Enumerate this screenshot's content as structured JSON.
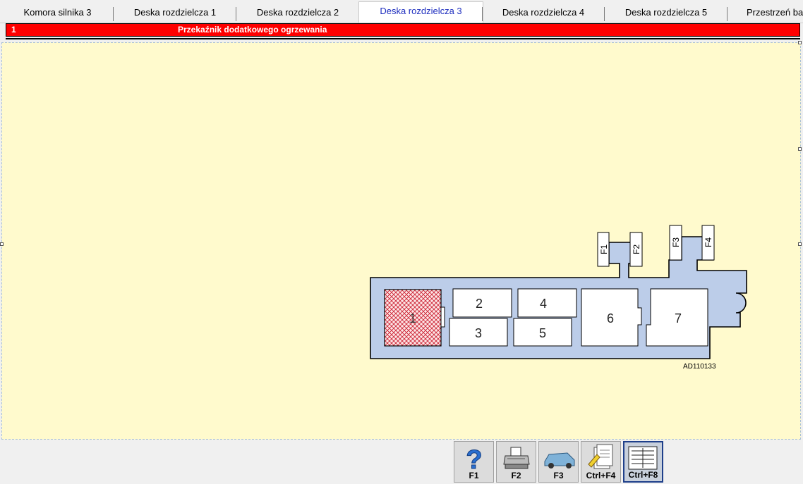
{
  "tabs": [
    {
      "label": "Komora silnika 3",
      "selected": false
    },
    {
      "label": "Deska rozdzielcza 1",
      "selected": false
    },
    {
      "label": "Deska rozdzielcza 2",
      "selected": false
    },
    {
      "label": "Deska rozdzielcza 3",
      "selected": true
    },
    {
      "label": "Deska rozdzielcza 4",
      "selected": false
    },
    {
      "label": "Deska rozdzielcza 5",
      "selected": false
    },
    {
      "label": "Przestrzeń ba",
      "selected": false
    }
  ],
  "header": {
    "number": "1",
    "title": "Przekaźnik dodatkowego ogrzewania",
    "color": "#ff0000"
  },
  "diagram": {
    "fuses": [
      "F1",
      "F2",
      "F3",
      "F4"
    ],
    "slots": [
      "1",
      "2",
      "3",
      "4",
      "5",
      "6",
      "7"
    ],
    "highlighted_slot": "1",
    "code": "AD110133"
  },
  "toolbar": {
    "buttons": [
      {
        "label": "F1",
        "icon": "help-question-icon"
      },
      {
        "label": "F2",
        "icon": "printer-icon"
      },
      {
        "label": "F3",
        "icon": "car-icon"
      },
      {
        "label": "Ctrl+F4",
        "icon": "note-pencil-icon"
      },
      {
        "label": "Ctrl+F8",
        "icon": "fuse-list-icon",
        "active": true
      }
    ]
  },
  "colors": {
    "panel_bg": "#fffacd",
    "diagram_body": "#bccde9",
    "highlight": "#cc2233"
  }
}
